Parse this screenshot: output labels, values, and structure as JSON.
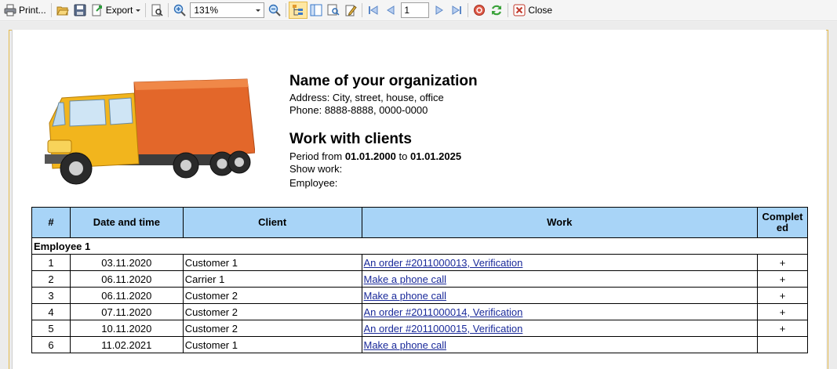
{
  "toolbar": {
    "print_label": "Print...",
    "export_label": "Export",
    "zoom_value": "131%",
    "page_value": "1",
    "close_label": "Close"
  },
  "report": {
    "org_name": "Name of your organization",
    "address": "Address: City, street, house, office",
    "phone": "Phone: 8888-8888, 0000-0000",
    "title": "Work with clients",
    "period_prefix": "Period from",
    "period_from": "01.01.2000",
    "period_to_word": "to",
    "period_to": "01.01.2025",
    "show_work": "Show work:",
    "employee": "Employee:"
  },
  "table": {
    "headers": [
      "#",
      "Date and time",
      "Client",
      "Work",
      "Complet ed"
    ],
    "group": "Employee 1",
    "rows": [
      {
        "n": "1",
        "date": "03.11.2020",
        "client": "Customer 1",
        "work": "An order #2011000013, Verification",
        "done": "+"
      },
      {
        "n": "2",
        "date": "06.11.2020",
        "client": "Carrier 1",
        "work": "Make a phone call",
        "done": "+"
      },
      {
        "n": "3",
        "date": "06.11.2020",
        "client": "Customer 2",
        "work": "Make a phone call",
        "done": "+"
      },
      {
        "n": "4",
        "date": "07.11.2020",
        "client": "Customer 2",
        "work": "An order #2011000014, Verification",
        "done": "+"
      },
      {
        "n": "5",
        "date": "10.11.2020",
        "client": "Customer 2",
        "work": "An order #2011000015, Verification",
        "done": "+"
      },
      {
        "n": "6",
        "date": "11.02.2021",
        "client": "Customer 1",
        "work": "Make a phone call",
        "done": ""
      }
    ]
  }
}
